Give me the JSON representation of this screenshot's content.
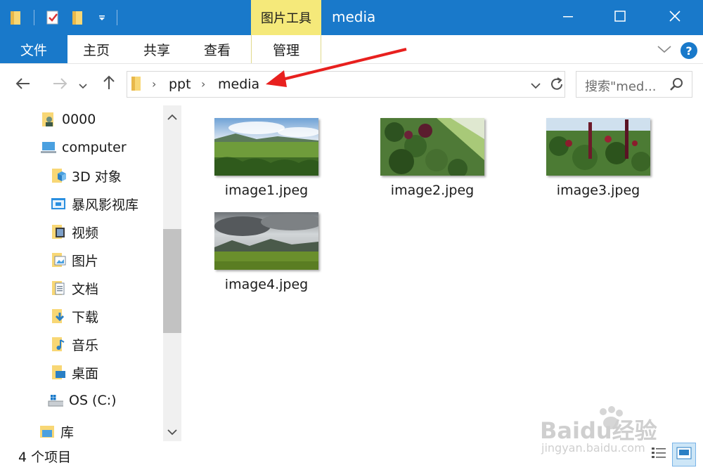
{
  "window": {
    "title": "media",
    "tool_tab": "图片工具",
    "minimize_icon": "minimize-icon",
    "maximize_icon": "maximize-icon",
    "close_icon": "close-icon"
  },
  "ribbon": {
    "tabs": [
      {
        "label": "文件",
        "active": true
      },
      {
        "label": "主页"
      },
      {
        "label": "共享"
      },
      {
        "label": "查看"
      },
      {
        "label": "管理"
      }
    ],
    "help_label": "?"
  },
  "navigation": {
    "breadcrumb": [
      "ppt",
      "media"
    ],
    "search_placeholder": "搜索\"med...",
    "annotation_arrow_color": "#e8201e"
  },
  "sidebar": {
    "items": [
      {
        "label": "0000",
        "icon": "user-folder-icon"
      },
      {
        "label": "computer",
        "icon": "computer-icon"
      },
      {
        "label": "3D 对象",
        "icon": "3d-objects-icon"
      },
      {
        "label": "暴风影视库",
        "icon": "media-library-icon"
      },
      {
        "label": "视频",
        "icon": "videos-icon"
      },
      {
        "label": "图片",
        "icon": "pictures-icon"
      },
      {
        "label": "文档",
        "icon": "documents-icon"
      },
      {
        "label": "下载",
        "icon": "downloads-icon"
      },
      {
        "label": "音乐",
        "icon": "music-icon"
      },
      {
        "label": "桌面",
        "icon": "desktop-icon"
      },
      {
        "label": "OS (C:)",
        "icon": "drive-icon"
      },
      {
        "label": "库",
        "icon": "library-icon"
      }
    ]
  },
  "files": [
    {
      "name": "image1.jpeg",
      "thumb": "green-meadow-sky"
    },
    {
      "name": "image2.jpeg",
      "thumb": "green-plants-slope"
    },
    {
      "name": "image3.jpeg",
      "thumb": "red-flower-plants"
    },
    {
      "name": "image4.jpeg",
      "thumb": "cloudy-mountains"
    }
  ],
  "status": {
    "item_count": "4 个项目"
  },
  "watermark": {
    "brand": "Baidu经验",
    "url": "jingyan.baidu.com"
  },
  "colors": {
    "titlebar": "#1979ca",
    "tool_tab": "#f5e97a"
  }
}
